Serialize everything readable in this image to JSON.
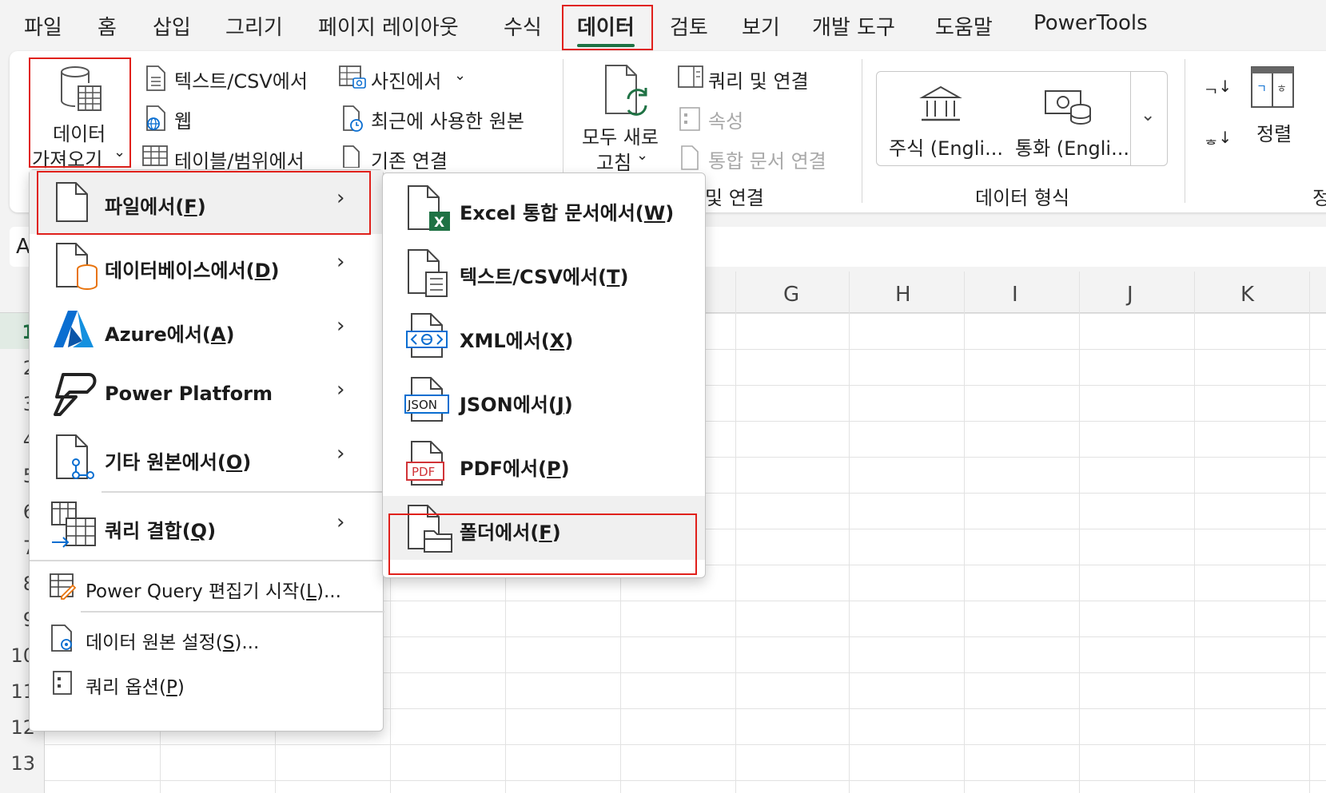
{
  "menubar": {
    "tabs": [
      "파일",
      "홈",
      "삽입",
      "그리기",
      "페이지 레이아웃",
      "수식",
      "데이터",
      "검토",
      "보기",
      "개발 도구",
      "도움말",
      "PowerTools"
    ],
    "active_tab": "데이터"
  },
  "ribbon": {
    "get_data": {
      "line1": "데이터",
      "line2": "가져오기"
    },
    "from_text_csv": "텍스트/CSV에서",
    "from_web": "웹",
    "from_table_range": "테이블/범위에서",
    "from_picture": "사진에서",
    "recent_sources": "최근에 사용한 원본",
    "existing_connections": "기존 연결",
    "refresh_all": {
      "line1": "모두 새로",
      "line2": "고침"
    },
    "queries_connections": "쿼리 및 연결",
    "properties": "속성",
    "edit_links": "통합 문서 연결",
    "group_queries_label": "및 연결",
    "stocks": "주식 (Engli...",
    "currencies": "통화 (Engli...",
    "group_datatypes_label": "데이터 형식",
    "sort": "정렬",
    "partial_right_label": "정"
  },
  "namebox": {
    "value": "A"
  },
  "sheet": {
    "columns": [
      "G",
      "H",
      "I",
      "J",
      "K"
    ],
    "rows": [
      "1",
      "2",
      "3",
      "4",
      "5",
      "6",
      "7",
      "8",
      "9",
      "10",
      "11",
      "12",
      "13"
    ]
  },
  "menu_get_data": {
    "items": [
      {
        "label": "파일에서",
        "key": "F",
        "submenu": true
      },
      {
        "label": "데이터베이스에서",
        "key": "D",
        "submenu": true
      },
      {
        "label": "Azure에서",
        "key": "A",
        "submenu": true
      },
      {
        "label": "Power Platform",
        "key": "",
        "submenu": true
      },
      {
        "label": "기타 원본에서",
        "key": "O",
        "submenu": true
      },
      {
        "label": "쿼리 결합",
        "key": "Q",
        "submenu": true
      }
    ],
    "bottom_items": [
      {
        "label": "Power Query 편집기 시작",
        "key": "L",
        "suffix": "..."
      },
      {
        "label": "데이터 원본 설정",
        "key": "S",
        "suffix": "..."
      },
      {
        "label": "쿼리 옵션",
        "key": "P",
        "suffix": ""
      }
    ]
  },
  "menu_from_file": {
    "items": [
      {
        "label": "Excel 통합 문서에서",
        "key": "W"
      },
      {
        "label": "텍스트/CSV에서",
        "key": "T"
      },
      {
        "label": "XML에서",
        "key": "X"
      },
      {
        "label": "JSON에서",
        "key": "J"
      },
      {
        "label": "PDF에서",
        "key": "P"
      },
      {
        "label": "폴더에서",
        "key": "F"
      }
    ]
  },
  "icons": {
    "json_badge": "JSON",
    "pdf_badge": "PDF",
    "excel_badge": "X"
  },
  "colors": {
    "accent_green": "#1f7244",
    "highlight_red": "#e0201b",
    "azure_blue": "#0a6ed1",
    "database_orange": "#e8730c"
  }
}
